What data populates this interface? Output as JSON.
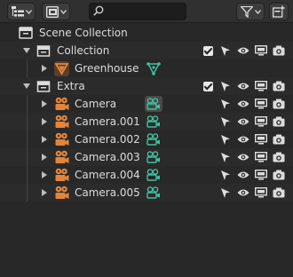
{
  "header": {
    "display_mode_icon": "outliner-display-icon",
    "view_icon": "image-icon",
    "search": {
      "value": "",
      "placeholder": ""
    },
    "filter_icon": "filter-funnel-icon",
    "new_collection_icon": "new-collection-icon"
  },
  "tree": {
    "scene": {
      "label": "Scene Collection"
    },
    "collection": {
      "label": "Collection"
    },
    "greenhouse": {
      "label": "Greenhouse"
    },
    "extra": {
      "label": "Extra"
    },
    "cameras": [
      {
        "label": "Camera"
      },
      {
        "label": "Camera.001"
      },
      {
        "label": "Camera.002"
      },
      {
        "label": "Camera.003"
      },
      {
        "label": "Camera.004"
      },
      {
        "label": "Camera.005"
      }
    ]
  },
  "colors": {
    "background": "#282828",
    "header": "#303030",
    "object_orange": "#e3853b",
    "data_green": "#3fc1a0"
  }
}
